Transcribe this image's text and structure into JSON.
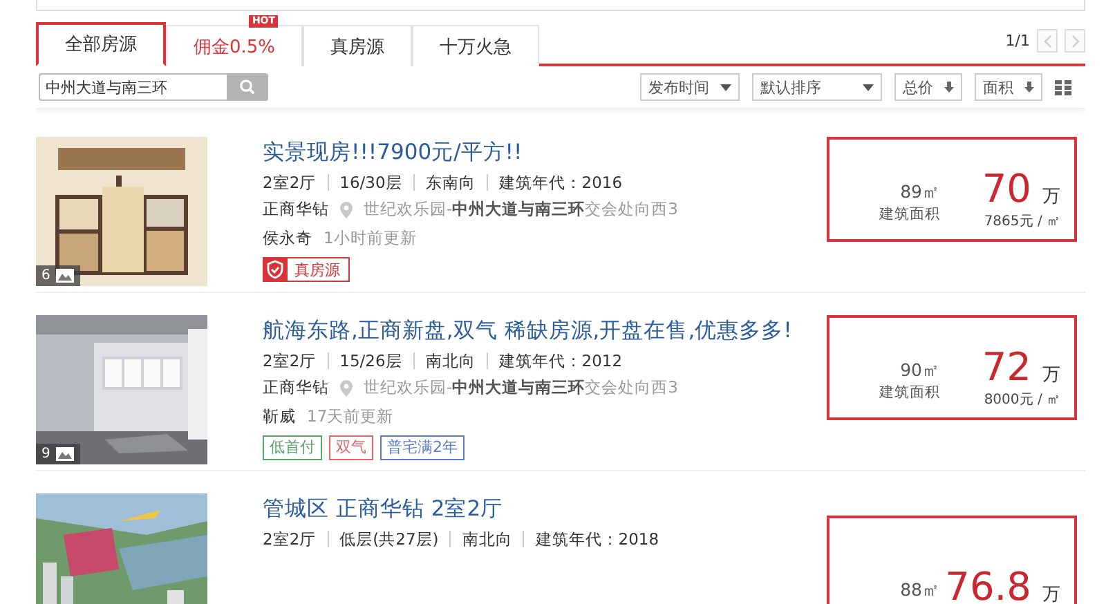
{
  "tabs": [
    {
      "label": "全部房源",
      "selected": true
    },
    {
      "label": "佣金0.5%",
      "selected": false,
      "kind": "promo",
      "badge": "HOT"
    },
    {
      "label": "真房源",
      "selected": false
    },
    {
      "label": "十万火急",
      "selected": false
    }
  ],
  "pagination": {
    "page": "1/1"
  },
  "search": {
    "value": "中州大道与南三环"
  },
  "filters": [
    {
      "label": "发布时间",
      "kind": "dropdown"
    },
    {
      "label": "默认排序",
      "kind": "dropdown"
    },
    {
      "label": "总价",
      "kind": "sort"
    },
    {
      "label": "面积",
      "kind": "sort"
    }
  ],
  "listings": [
    {
      "title": "实景现房!!!7900元/平方!!",
      "photo_count": "6",
      "details": [
        "2室2厅",
        "16/30层",
        "东南向",
        "建筑年代：2016"
      ],
      "estate": "正商华钻",
      "location": "世纪欢乐园-**中州大道与南三环**交会处向西3",
      "agent": "侯永奇",
      "updated": "1小时前更新",
      "tags": [
        {
          "label": "真房源",
          "kind": "verified"
        }
      ],
      "area": "89㎡",
      "area_label": "建筑面积",
      "price": "70",
      "price_unit": "万",
      "unit_price": "7865元 / ㎡"
    },
    {
      "title": "航海东路,正商新盘,双气 稀缺房源,开盘在售,优惠多多!",
      "photo_count": "9",
      "details": [
        "2室2厅",
        "15/26层",
        "南北向",
        "建筑年代：2012"
      ],
      "estate": "正商华钻",
      "location": "世纪欢乐园-**中州大道与南三环**交会处向西3",
      "agent": "靳威",
      "updated": "17天前更新",
      "tags": [
        {
          "label": "低首付",
          "kind": "plain",
          "color": "#5aa46a"
        },
        {
          "label": "双气",
          "kind": "plain",
          "color": "#e0666a"
        },
        {
          "label": "普宅满2年",
          "kind": "plain",
          "color": "#5b7fc4"
        }
      ],
      "area": "90㎡",
      "area_label": "建筑面积",
      "price": "72",
      "price_unit": "万",
      "unit_price": "8000元 / ㎡"
    },
    {
      "title": "管城区 正商华钻 2室2厅",
      "details": [
        "2室2厅",
        "低层(共27层)",
        "南北向",
        "建筑年代：2018"
      ],
      "area": "88㎡",
      "price": "76.8",
      "price_unit": "万"
    }
  ]
}
